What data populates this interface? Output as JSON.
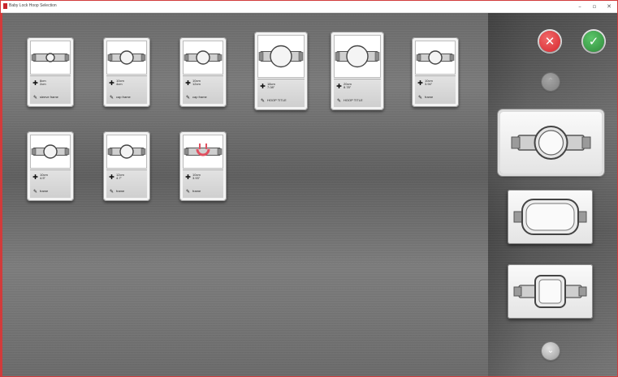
{
  "window": {
    "title": "Baby Lock Hoop Selection",
    "minimize": "–",
    "maximize": "▫",
    "close": "✕"
  },
  "actions": {
    "cancel_icon": "close-icon",
    "cancel_color": "#d8262e",
    "confirm_icon": "check-icon",
    "confirm_color": "#2e8b3a"
  },
  "scroll": {
    "up_glyph": "⌃",
    "down_glyph": "⌄"
  },
  "hoops": [
    {
      "size": "8cm\n2cm",
      "line2": "",
      "name": "sleeve frame"
    },
    {
      "size": "10cm\n4cm",
      "line2": "",
      "name": "cap frame"
    },
    {
      "size": "10cm\n12cm",
      "line2": "",
      "name": "cap frame"
    },
    {
      "size": "18cm\n7.08\"",
      "line2": "",
      "name": "HOOP TITLE"
    },
    {
      "size": "20cm\n8.78\"",
      "line2": "",
      "name": "HOOP TITLE"
    },
    {
      "size": "10cm\n3.94\"",
      "line2": "",
      "name": "frame"
    },
    {
      "size": "10cm\n4.5\"",
      "line2": "",
      "name": "frame"
    },
    {
      "size": "12cm\n4.7\"",
      "line2": "",
      "name": "frame"
    },
    {
      "size": "10cm\n3.93\"",
      "line2": "",
      "name": "frame"
    }
  ],
  "hoop_types": [
    {
      "name": "round-hoop",
      "selected": true
    },
    {
      "name": "rounded-rect-hoop",
      "selected": false
    },
    {
      "name": "square-hoop",
      "selected": false
    }
  ]
}
